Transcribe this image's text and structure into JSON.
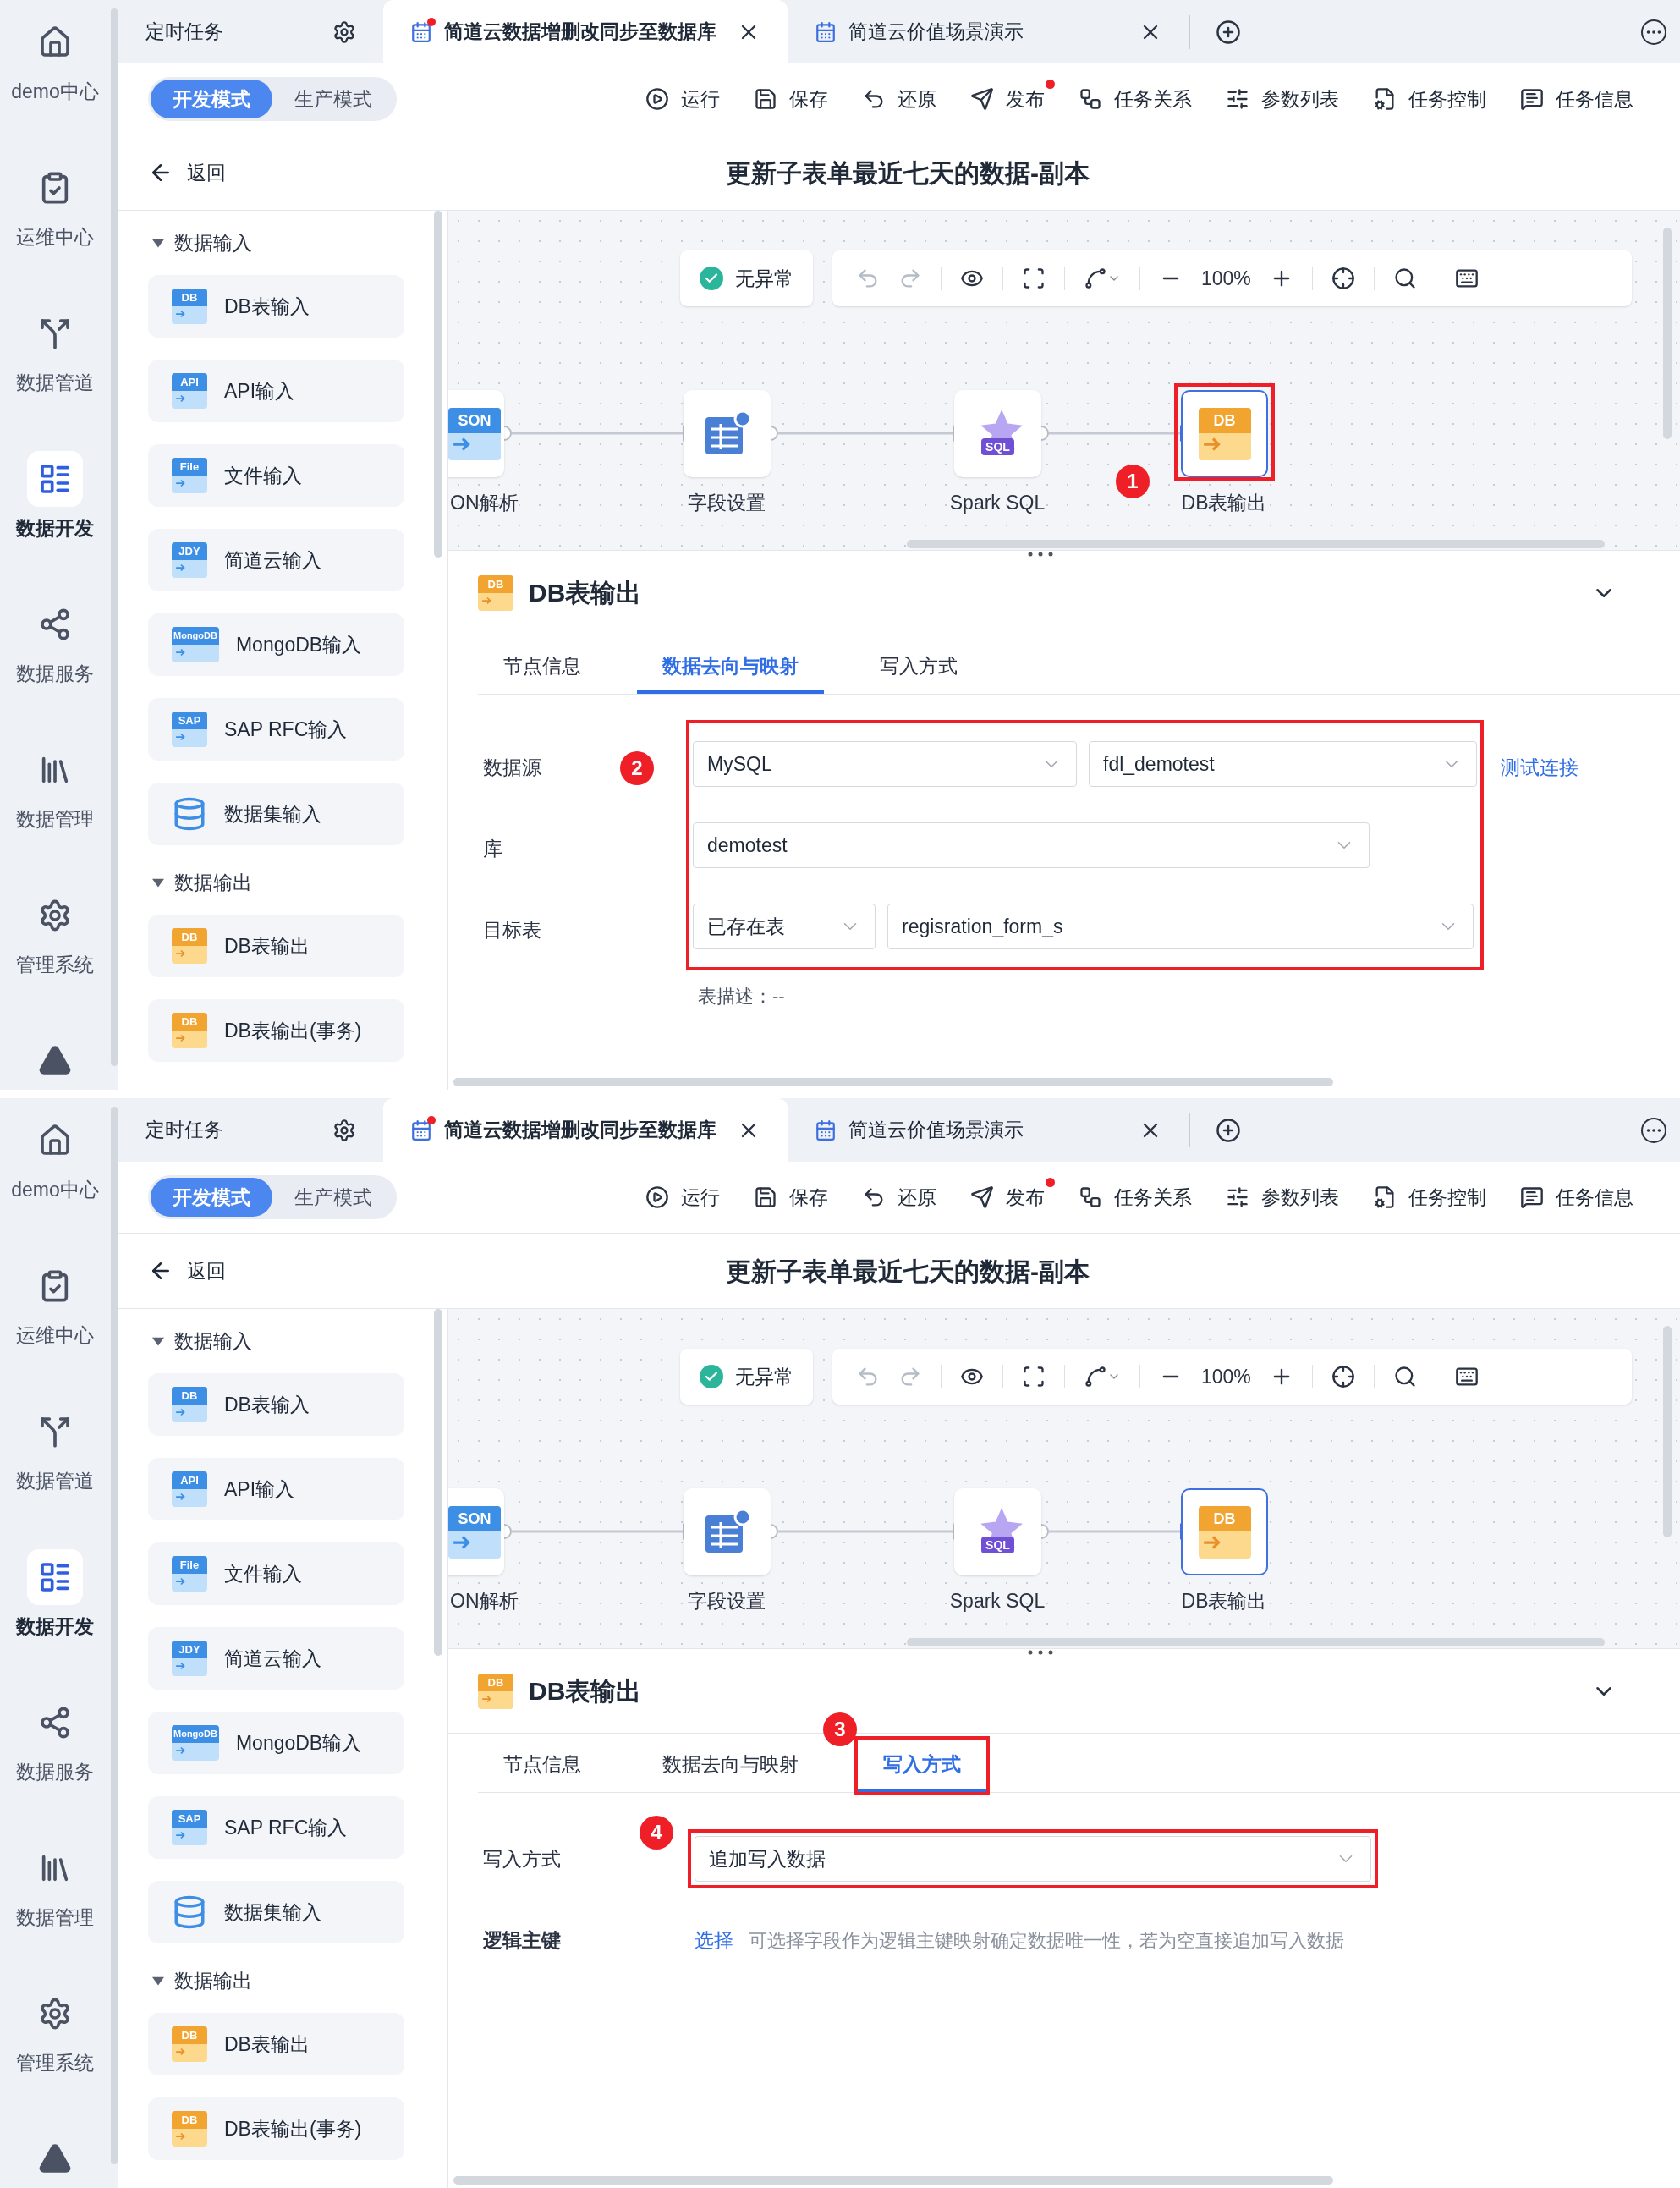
{
  "screens": [
    {
      "nav": [
        {
          "label": "demo中心",
          "selected": false
        },
        {
          "label": "运维中心",
          "selected": false
        },
        {
          "label": "数据管道",
          "selected": false
        },
        {
          "label": "数据开发",
          "selected": true
        },
        {
          "label": "数据服务",
          "selected": false
        },
        {
          "label": "数据管理",
          "selected": false
        },
        {
          "label": "管理系统",
          "selected": false
        }
      ],
      "tabs": [
        {
          "kind": "settings",
          "label": "定时任务",
          "selected": false
        },
        {
          "kind": "task",
          "label": "简道云数据增删改同步至数据库",
          "selected": true,
          "unsaved": true
        },
        {
          "kind": "task",
          "label": "简道云价值场景演示",
          "selected": false,
          "unsaved": false
        }
      ],
      "modes": [
        {
          "label": "开发模式",
          "selected": true
        },
        {
          "label": "生产模式",
          "selected": false
        }
      ],
      "actions": [
        {
          "label": "运行",
          "notice": false
        },
        {
          "label": "保存",
          "notice": false
        },
        {
          "label": "还原",
          "notice": false
        },
        {
          "label": "发布",
          "notice": true
        },
        {
          "label": "任务关系",
          "notice": false
        },
        {
          "label": "参数列表",
          "notice": false
        },
        {
          "label": "任务控制",
          "notice": false
        },
        {
          "label": "任务信息",
          "notice": false
        }
      ],
      "back": "返回",
      "title": "更新子表单最近七天的数据-副本",
      "palette": [
        {
          "label": "数据输入",
          "kind": "input",
          "expanded": true,
          "items": [
            {
              "label": "DB表输入",
              "icon_text": "DB"
            },
            {
              "label": "API输入",
              "icon_text": "API"
            },
            {
              "label": "文件输入",
              "icon_text": "File"
            },
            {
              "label": "简道云输入",
              "icon_text": "JDY"
            },
            {
              "label": "MongoDB输入",
              "icon_text": "MongoDB"
            },
            {
              "label": "SAP RFC输入",
              "icon_text": "SAP"
            },
            {
              "label": "数据集输入"
            }
          ]
        },
        {
          "label": "数据输出",
          "kind": "output",
          "expanded": true,
          "items": [
            {
              "label": "DB表输出",
              "icon_text": "DB"
            },
            {
              "label": "DB表输出(事务)",
              "icon_text": "DB"
            }
          ]
        }
      ],
      "canvas": {
        "status": "无异常",
        "zoom": "100%",
        "nodes": [
          {
            "kind": "json",
            "icon_text": "SON",
            "label": "ON解析",
            "selected": false
          },
          {
            "kind": "fields",
            "label": "字段设置",
            "selected": false
          },
          {
            "kind": "sql",
            "icon_text": "SQL",
            "label": "Spark SQL",
            "selected": false
          },
          {
            "kind": "db",
            "icon_text": "DB",
            "label": "DB表输出",
            "selected": true,
            "annotation": "1"
          }
        ]
      },
      "panel": {
        "icon_text": "DB",
        "title": "DB表输出",
        "tabs": [
          {
            "label": "节点信息",
            "selected": false
          },
          {
            "label": "数据去向与映射",
            "selected": true
          },
          {
            "label": "写入方式",
            "selected": false
          }
        ],
        "form": {
          "annotation": "2",
          "rows": [
            {
              "kind": "select",
              "label": "数据源",
              "fields": [
                "MySQL",
                "fdl_demotest"
              ],
              "link": "测试连接"
            },
            {
              "kind": "select",
              "label": "库",
              "fields": [
                "demotest"
              ]
            },
            {
              "kind": "select",
              "label": "目标表",
              "fields": [
                "已存在表",
                "regisration_form_s"
              ]
            }
          ],
          "note": "表描述：--"
        }
      }
    },
    {
      "nav": [
        {
          "label": "demo中心",
          "selected": false
        },
        {
          "label": "运维中心",
          "selected": false
        },
        {
          "label": "数据管道",
          "selected": false
        },
        {
          "label": "数据开发",
          "selected": true
        },
        {
          "label": "数据服务",
          "selected": false
        },
        {
          "label": "数据管理",
          "selected": false
        },
        {
          "label": "管理系统",
          "selected": false
        }
      ],
      "tabs": [
        {
          "kind": "settings",
          "label": "定时任务",
          "selected": false
        },
        {
          "kind": "task",
          "label": "简道云数据增删改同步至数据库",
          "selected": true,
          "unsaved": true
        },
        {
          "kind": "task",
          "label": "简道云价值场景演示",
          "selected": false,
          "unsaved": false
        }
      ],
      "modes": [
        {
          "label": "开发模式",
          "selected": true
        },
        {
          "label": "生产模式",
          "selected": false
        }
      ],
      "actions": [
        {
          "label": "运行",
          "notice": false
        },
        {
          "label": "保存",
          "notice": false
        },
        {
          "label": "还原",
          "notice": false
        },
        {
          "label": "发布",
          "notice": true
        },
        {
          "label": "任务关系",
          "notice": false
        },
        {
          "label": "参数列表",
          "notice": false
        },
        {
          "label": "任务控制",
          "notice": false
        },
        {
          "label": "任务信息",
          "notice": false
        }
      ],
      "back": "返回",
      "title": "更新子表单最近七天的数据-副本",
      "palette": [
        {
          "label": "数据输入",
          "kind": "input",
          "expanded": true,
          "items": [
            {
              "label": "DB表输入",
              "icon_text": "DB"
            },
            {
              "label": "API输入",
              "icon_text": "API"
            },
            {
              "label": "文件输入",
              "icon_text": "File"
            },
            {
              "label": "简道云输入",
              "icon_text": "JDY"
            },
            {
              "label": "MongoDB输入",
              "icon_text": "MongoDB"
            },
            {
              "label": "SAP RFC输入",
              "icon_text": "SAP"
            },
            {
              "label": "数据集输入"
            }
          ]
        },
        {
          "label": "数据输出",
          "kind": "output",
          "expanded": true,
          "items": [
            {
              "label": "DB表输出",
              "icon_text": "DB"
            },
            {
              "label": "DB表输出(事务)",
              "icon_text": "DB"
            }
          ]
        }
      ],
      "canvas": {
        "status": "无异常",
        "zoom": "100%",
        "nodes": [
          {
            "kind": "json",
            "icon_text": "SON",
            "label": "ON解析",
            "selected": false
          },
          {
            "kind": "fields",
            "label": "字段设置",
            "selected": false
          },
          {
            "kind": "sql",
            "icon_text": "SQL",
            "label": "Spark SQL",
            "selected": false
          },
          {
            "kind": "db",
            "icon_text": "DB",
            "label": "DB表输出",
            "selected": true
          }
        ]
      },
      "panel": {
        "icon_text": "DB",
        "title": "DB表输出",
        "tabs": [
          {
            "label": "节点信息",
            "selected": false
          },
          {
            "label": "数据去向与映射",
            "selected": false
          },
          {
            "label": "写入方式",
            "selected": true,
            "annotation": "3"
          }
        ],
        "form": {
          "rows": [
            {
              "kind": "select",
              "label": "写入方式",
              "fields": [
                "追加写入数据"
              ],
              "annotation": "4"
            },
            {
              "kind": "picker",
              "label": "逻辑主键",
              "link": "选择",
              "hint": "可选择字段作为逻辑主键映射确定数据唯一性，若为空直接追加写入数据"
            }
          ]
        }
      }
    }
  ]
}
